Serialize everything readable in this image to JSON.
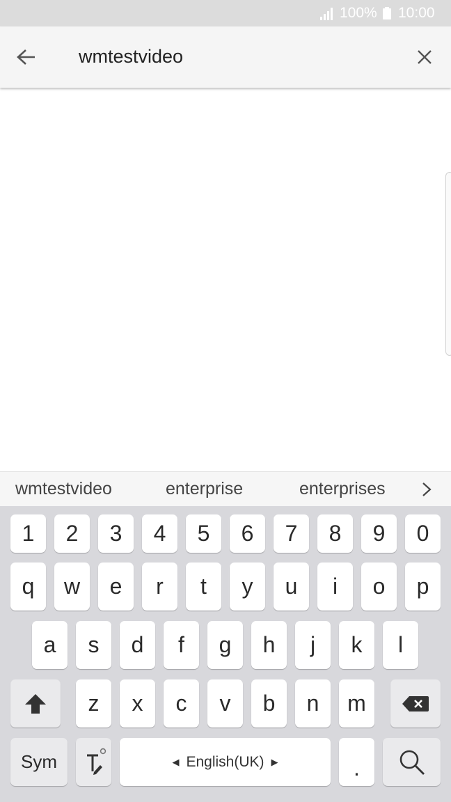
{
  "status_bar": {
    "battery": "100%",
    "time": "10:00"
  },
  "search_bar": {
    "query": "wmtestvideo"
  },
  "suggestions": [
    "wmtestvideo",
    "enterprise",
    "enterprises"
  ],
  "keyboard": {
    "numbers": [
      "1",
      "2",
      "3",
      "4",
      "5",
      "6",
      "7",
      "8",
      "9",
      "0"
    ],
    "row1": [
      "q",
      "w",
      "e",
      "r",
      "t",
      "y",
      "u",
      "i",
      "o",
      "p"
    ],
    "row2": [
      "a",
      "s",
      "d",
      "f",
      "g",
      "h",
      "j",
      "k",
      "l"
    ],
    "row3": [
      "z",
      "x",
      "c",
      "v",
      "b",
      "n",
      "m"
    ],
    "sym_label": "Sym",
    "language_label": "English(UK)",
    "period_label": "."
  },
  "colors": {
    "status_bar_bg": "#dcdcdc",
    "app_bar_bg": "#f5f5f5",
    "keyboard_bg": "#d8d8dc"
  }
}
